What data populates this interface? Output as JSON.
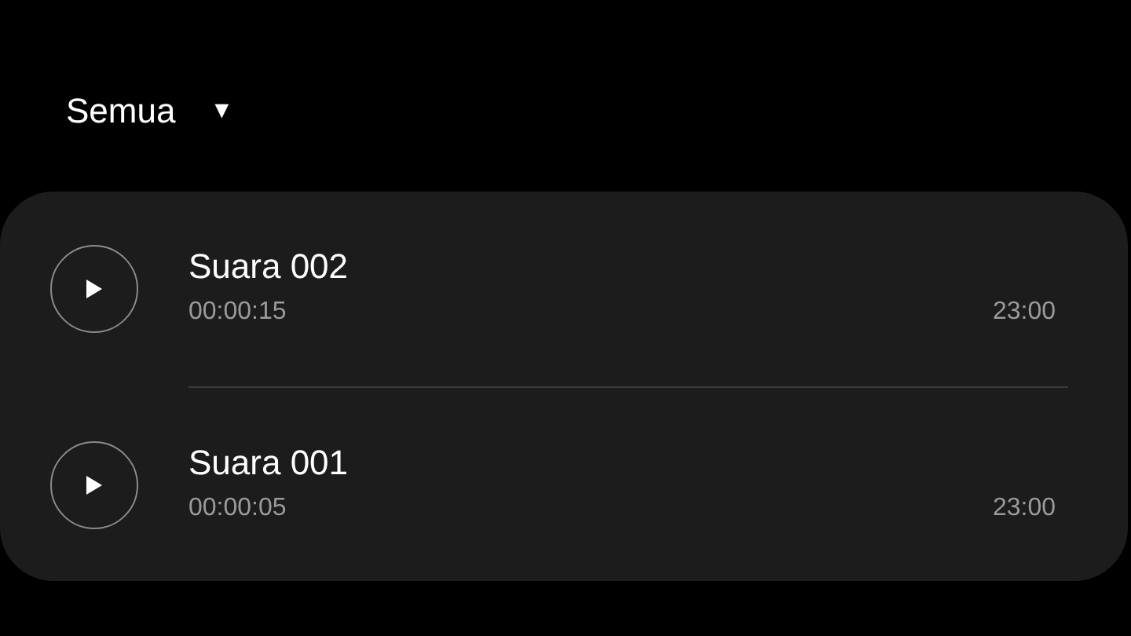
{
  "filter": {
    "label": "Semua",
    "caret": "▼"
  },
  "recordings": [
    {
      "title": "Suara 002",
      "duration": "00:00:15",
      "time": "23:00"
    },
    {
      "title": "Suara 001",
      "duration": "00:00:05",
      "time": "23:00"
    }
  ]
}
